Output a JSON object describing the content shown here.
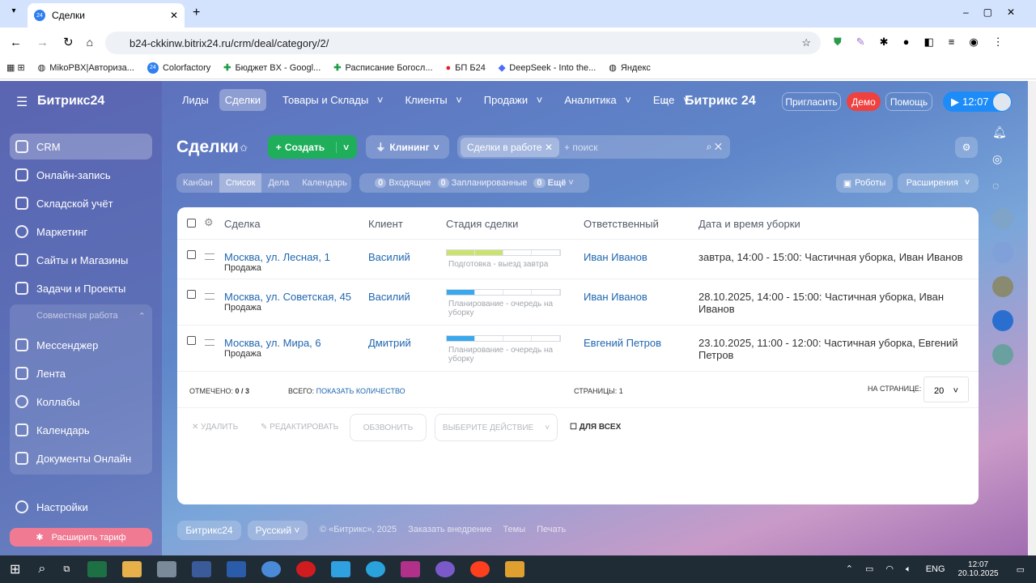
{
  "browser": {
    "tab_title": "Сделки",
    "url": "b24-ckkinw.bitrix24.ru/crm/deal/category/2/",
    "bookmarks": [
      "MikoPBX|Авториза...",
      "Colorfactory",
      "Бюджет BX - Googl...",
      "Расписание Богосл...",
      "БП Б24",
      "DeepSeek - Into the...",
      "Яндекс"
    ]
  },
  "header": {
    "logo": "Битрикс24",
    "nav": [
      "Лиды",
      "Сделки",
      "Товары и Склады",
      "Клиенты",
      "Продажи",
      "Аналитика",
      "Еще"
    ],
    "brand": "Битрикс 24",
    "invite": "Пригласить",
    "demo": "Демо",
    "help": "Помощь",
    "time": "12:07"
  },
  "sidebar": {
    "items": [
      "CRM",
      "Онлайн-запись",
      "Складской учёт",
      "Маркетинг",
      "Сайты и Магазины",
      "Задачи и Проекты",
      "Совместная работа",
      "Мессенджер",
      "Лента",
      "Коллабы",
      "Календарь",
      "Документы Онлайн"
    ],
    "settings": "Настройки",
    "upgrade": "Расширить тариф"
  },
  "toolbar": {
    "title": "Сделки",
    "create": "Создать",
    "category": "Клининг",
    "filter_chip": "Сделки в работе",
    "search_placeholder": "+ поиск",
    "views": [
      "Канбан",
      "Список",
      "Дела",
      "Календарь"
    ],
    "counters": [
      {
        "n": "0",
        "label": "Входящие"
      },
      {
        "n": "0",
        "label": "Запланированные"
      },
      {
        "n": "0",
        "label": "Ещё"
      }
    ],
    "robots": "Роботы",
    "extensions": "Расширения"
  },
  "table": {
    "columns": [
      "Сделка",
      "Клиент",
      "Стадия сделки",
      "Ответственный",
      "Дата и время уборки"
    ],
    "rows": [
      {
        "deal": "Москва, ул. Лесная, 1",
        "type": "Продажа",
        "client": "Василий",
        "stage": "Подготовка - выезд завтра",
        "stage_progress": 2,
        "stage_color": "#cbe36c",
        "owner": "Иван Иванов",
        "cleaning": "завтра, 14:00 - 15:00: Частичная уборка, Иван Иванов"
      },
      {
        "deal": "Москва, ул. Советская, 45",
        "type": "Продажа",
        "client": "Василий",
        "stage": "Планирование - очередь на уборку",
        "stage_progress": 1,
        "stage_color": "#39a8ef",
        "owner": "Иван Иванов",
        "cleaning": "28.10.2025, 14:00 - 15:00: Частичная уборка, Иван Иванов"
      },
      {
        "deal": "Москва, ул. Мира, 6",
        "type": "Продажа",
        "client": "Дмитрий",
        "stage": "Планирование - очередь на уборку",
        "stage_progress": 1,
        "stage_color": "#39a8ef",
        "owner": "Евгений Петров",
        "cleaning": "23.10.2025, 11:00 - 12:00: Частичная уборка, Евгений Петров"
      }
    ],
    "stage_segments": 4
  },
  "footer": {
    "checked_label": "Отмечено:",
    "checked": "0 / 3",
    "total_label": "Всего:",
    "total_link": "Показать количество",
    "pages_label": "Страницы:",
    "pages": "1",
    "per_page_label": "На странице:",
    "per_page": "20",
    "delete": "Удалить",
    "edit": "Редактировать",
    "call": "Обзвонить",
    "action": "Выберите действие",
    "for_all": "Для всех"
  },
  "page_footer": {
    "brand": "Битрикс24",
    "lang": "Русский",
    "copy": "© «Битрикс», 2025",
    "order": "Заказать внедрение",
    "themes": "Темы",
    "print": "Печать"
  },
  "taskbar": {
    "lang": "ENG",
    "time": "12:07",
    "date": "20.10.2025"
  }
}
